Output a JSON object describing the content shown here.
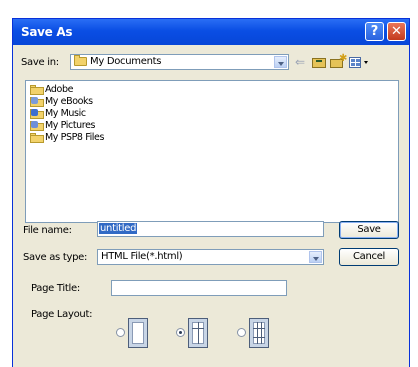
{
  "window": {
    "title": "Save As"
  },
  "titlebar_buttons": {
    "help": "?",
    "close": "✕"
  },
  "save_in": {
    "label": "Save in:",
    "value": "My Documents"
  },
  "toolbar": {
    "back_glyph": "⇐"
  },
  "files": [
    {
      "name": "Adobe",
      "icon": "folder-icon"
    },
    {
      "name": "My eBooks",
      "icon": "ebooks-folder-icon"
    },
    {
      "name": "My Music",
      "icon": "music-folder-icon"
    },
    {
      "name": "My Pictures",
      "icon": "pictures-folder-icon"
    },
    {
      "name": "My PSP8 Files",
      "icon": "folder-icon"
    }
  ],
  "file_name": {
    "label": "File name:",
    "value": "untitled"
  },
  "save_as_type": {
    "label": "Save as type:",
    "value": "HTML File(*.html)"
  },
  "buttons": {
    "save": "Save",
    "cancel": "Cancel"
  },
  "page_title": {
    "label": "Page Title:",
    "value": ""
  },
  "page_layout": {
    "label": "Page Layout:",
    "options": [
      "single-page",
      "two-column",
      "three-column"
    ],
    "selected": "two-column"
  }
}
